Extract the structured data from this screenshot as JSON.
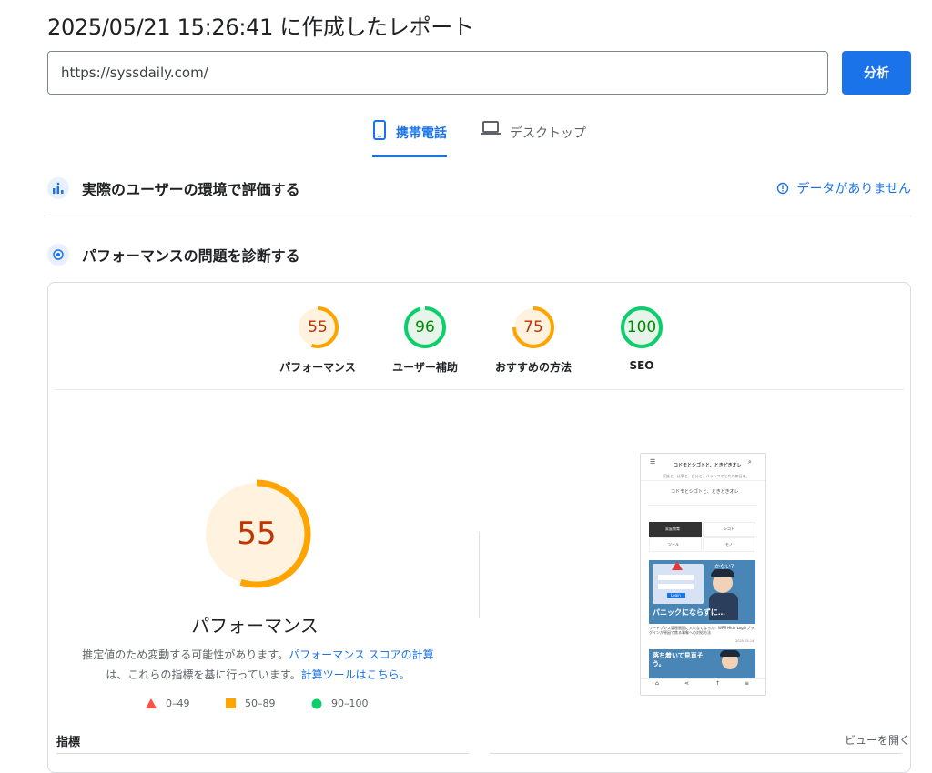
{
  "header": {
    "title": "2025/05/21 15:26:41 に作成したレポート"
  },
  "search": {
    "url_value": "https://syssdaily.com/",
    "analyze_label": "分析"
  },
  "tabs": [
    {
      "label": "携帯電話",
      "icon": "smartphone-icon",
      "active": true
    },
    {
      "label": "デスクトップ",
      "icon": "laptop-icon",
      "active": false
    }
  ],
  "field_data": {
    "title": "実際のユーザーの環境で評価する",
    "status": "データがありません",
    "icon": "info-icon"
  },
  "lab": {
    "title": "パフォーマンスの問題を診断する"
  },
  "scores": [
    {
      "label": "パフォーマンス",
      "value": "55",
      "fraction": 0.55,
      "color": "#ffa400",
      "text": "#c33300",
      "bg": "#fff3e0"
    },
    {
      "label": "ユーザー補助",
      "value": "96",
      "fraction": 0.96,
      "color": "#0cce6b",
      "text": "#008800",
      "bg": "#e6f4ea"
    },
    {
      "label": "おすすめの方法",
      "value": "75",
      "fraction": 0.75,
      "color": "#ffa400",
      "text": "#c33300",
      "bg": "#fff3e0"
    },
    {
      "label": "SEO",
      "value": "100",
      "fraction": 1.0,
      "color": "#0cce6b",
      "text": "#008800",
      "bg": "#e6f4ea"
    }
  ],
  "performance": {
    "score": "55",
    "fraction": 0.55,
    "title": "パフォーマンス",
    "desc_1": "推定値のため変動する可能性があります。",
    "desc_link_1": "パフォーマンス スコアの計算",
    "desc_2": "は、これらの指標を基に行っています。",
    "desc_link_2": "計算ツールはこちら。"
  },
  "legend": [
    {
      "label": "0–49",
      "shape": "triangle",
      "color": "#ff4e42"
    },
    {
      "label": "50–89",
      "shape": "square",
      "color": "#ffa400"
    },
    {
      "label": "90–100",
      "shape": "circle",
      "color": "#0cce6b"
    }
  ],
  "metrics": {
    "title": "指標",
    "expand_label": "ビューを開く"
  },
  "screenshot": {
    "site_title": "コドモとシゴトと、ときどきオレ",
    "tagline": "家族と、仕事と、自分と。バランスのとれた毎日を。",
    "subtitle": "コドモとシゴトと、ときどきオレ",
    "menu_1": "家庭教育",
    "menu_2": "シゴト",
    "menu_3": "ツール",
    "menu_4": "モノ",
    "banner_text": "パニックにならずに…",
    "banner_q": "かない？",
    "login_label": "Login",
    "post_title": "ワードプレス管理画面に入れなくなった！WPS Hide Loginプラグインが原因で焦る事象への対処方法",
    "post_date": "2025-05-14",
    "card2_text": "落ち着いて見直そう。"
  }
}
